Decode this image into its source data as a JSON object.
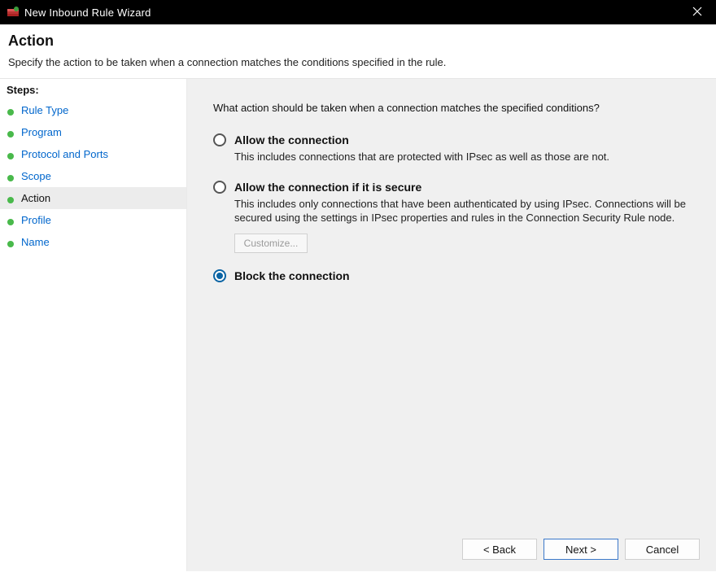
{
  "window": {
    "title": "New Inbound Rule Wizard"
  },
  "header": {
    "title": "Action",
    "subtitle": "Specify the action to be taken when a connection matches the conditions specified in the rule."
  },
  "sidebar": {
    "heading": "Steps:",
    "items": [
      {
        "label": "Rule Type"
      },
      {
        "label": "Program"
      },
      {
        "label": "Protocol and Ports"
      },
      {
        "label": "Scope"
      },
      {
        "label": "Action",
        "current": true
      },
      {
        "label": "Profile"
      },
      {
        "label": "Name"
      }
    ]
  },
  "main": {
    "prompt": "What action should be taken when a connection matches the specified conditions?",
    "options": {
      "allow": {
        "title": "Allow the connection",
        "desc": "This includes connections that are protected with IPsec as well as those are not."
      },
      "allow_secure": {
        "title": "Allow the connection if it is secure",
        "desc": "This includes only connections that have been authenticated by using IPsec.  Connections will be secured using the settings in IPsec properties and rules in the Connection Security Rule node.",
        "customize_label": "Customize..."
      },
      "block": {
        "title": "Block the connection"
      }
    },
    "selected": "block"
  },
  "footer": {
    "back": "< Back",
    "next": "Next >",
    "cancel": "Cancel"
  }
}
